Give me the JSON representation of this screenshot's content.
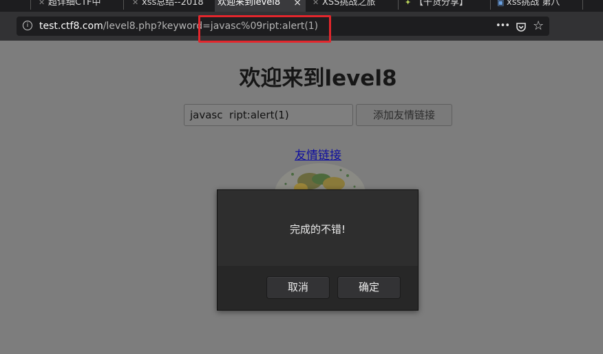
{
  "browser": {
    "tabs": [
      {
        "label": "超详细CTF中"
      },
      {
        "label": "xss总结--2018"
      },
      {
        "label": "欢迎来到level8",
        "active": true
      },
      {
        "label": "XSS挑战之旅"
      },
      {
        "label": "【干货分享】"
      },
      {
        "label": "xss挑战 第八"
      }
    ],
    "tab_close": "×",
    "url_host": "test.ctf8.com",
    "url_path": "/level8.php?keyword=javasc%09ript:alert(1)",
    "url_prefix": "",
    "actions": {
      "more": "•••",
      "pocket": "pocket",
      "bookmark": "☆"
    }
  },
  "page": {
    "title": "欢迎来到level8",
    "keyword_value": "javasc  ript:alert(1)",
    "add_link_label": "添加友情链接",
    "friend_link": "友情链接"
  },
  "dialog": {
    "message": "完成的不错!",
    "cancel_label": "取消",
    "ok_label": "确定"
  },
  "colors": {
    "highlight": "#e3262c",
    "page_dim": "#7d7d7d",
    "dialog_bg": "#2b2b2b"
  }
}
